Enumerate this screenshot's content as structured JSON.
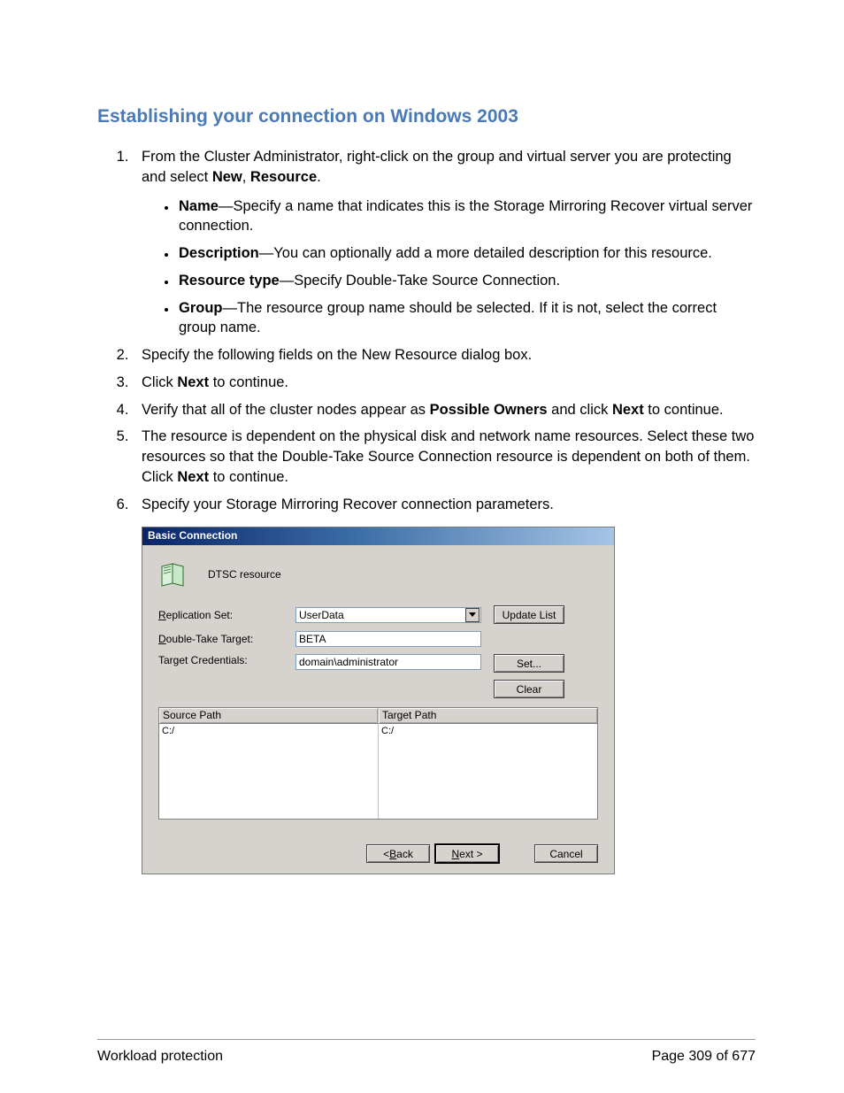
{
  "title": "Establishing your connection on Windows 2003",
  "list": {
    "item1_pre": "From the Cluster Administrator, right-click on the group and virtual server you are protecting and select ",
    "item1_b1": "New",
    "item1_mid": ", ",
    "item1_b2": "Resource",
    "item1_post": ".",
    "sub": {
      "name_b": "Name",
      "name_t": "—Specify a name that indicates this is the Storage Mirroring Recover virtual server connection.",
      "desc_b": "Description",
      "desc_t": "—You can optionally add a more detailed description for this resource.",
      "rtype_b": "Resource type",
      "rtype_t": "—Specify Double-Take Source Connection.",
      "group_b": "Group",
      "group_t": "—The resource group name should be selected. If it is not, select the correct group name."
    },
    "item2": "Specify the following fields on the New Resource dialog box.",
    "item3_pre": "Click ",
    "item3_b": "Next",
    "item3_post": " to continue.",
    "item4_pre": "Verify that all of the cluster nodes appear as ",
    "item4_b1": "Possible Owners",
    "item4_mid": " and click ",
    "item4_b2": "Next",
    "item4_post": " to continue.",
    "item5_pre": "The resource is dependent on the physical disk and network name resources. Select these two resources so that the Double-Take Source Connection resource is dependent on both of them. Click ",
    "item5_b": "Next",
    "item5_post": " to continue.",
    "item6": "Specify your Storage Mirroring Recover connection parameters."
  },
  "dialog": {
    "title": "Basic Connection",
    "resource": "DTSC resource",
    "labels": {
      "rep_pre_u": "R",
      "rep_rest": "eplication Set:",
      "dt_pre_u": "D",
      "dt_rest": "ouble-Take Target:",
      "tc": "Target Credentials:"
    },
    "values": {
      "replication_set": "UserData",
      "target": "BETA",
      "credentials": "domain\\administrator"
    },
    "buttons": {
      "update_list": "Update List",
      "set": "Set...",
      "clear": "Clear",
      "back_u": "B",
      "back_pre": "< ",
      "back_rest": "ack",
      "next_u": "N",
      "next_rest": "ext >",
      "cancel": "Cancel"
    },
    "paths": {
      "source_header": "Source Path",
      "target_header": "Target Path",
      "source_value": "C:/",
      "target_value": "C:/"
    }
  },
  "footer": {
    "left": "Workload protection",
    "right": "Page 309 of 677"
  }
}
